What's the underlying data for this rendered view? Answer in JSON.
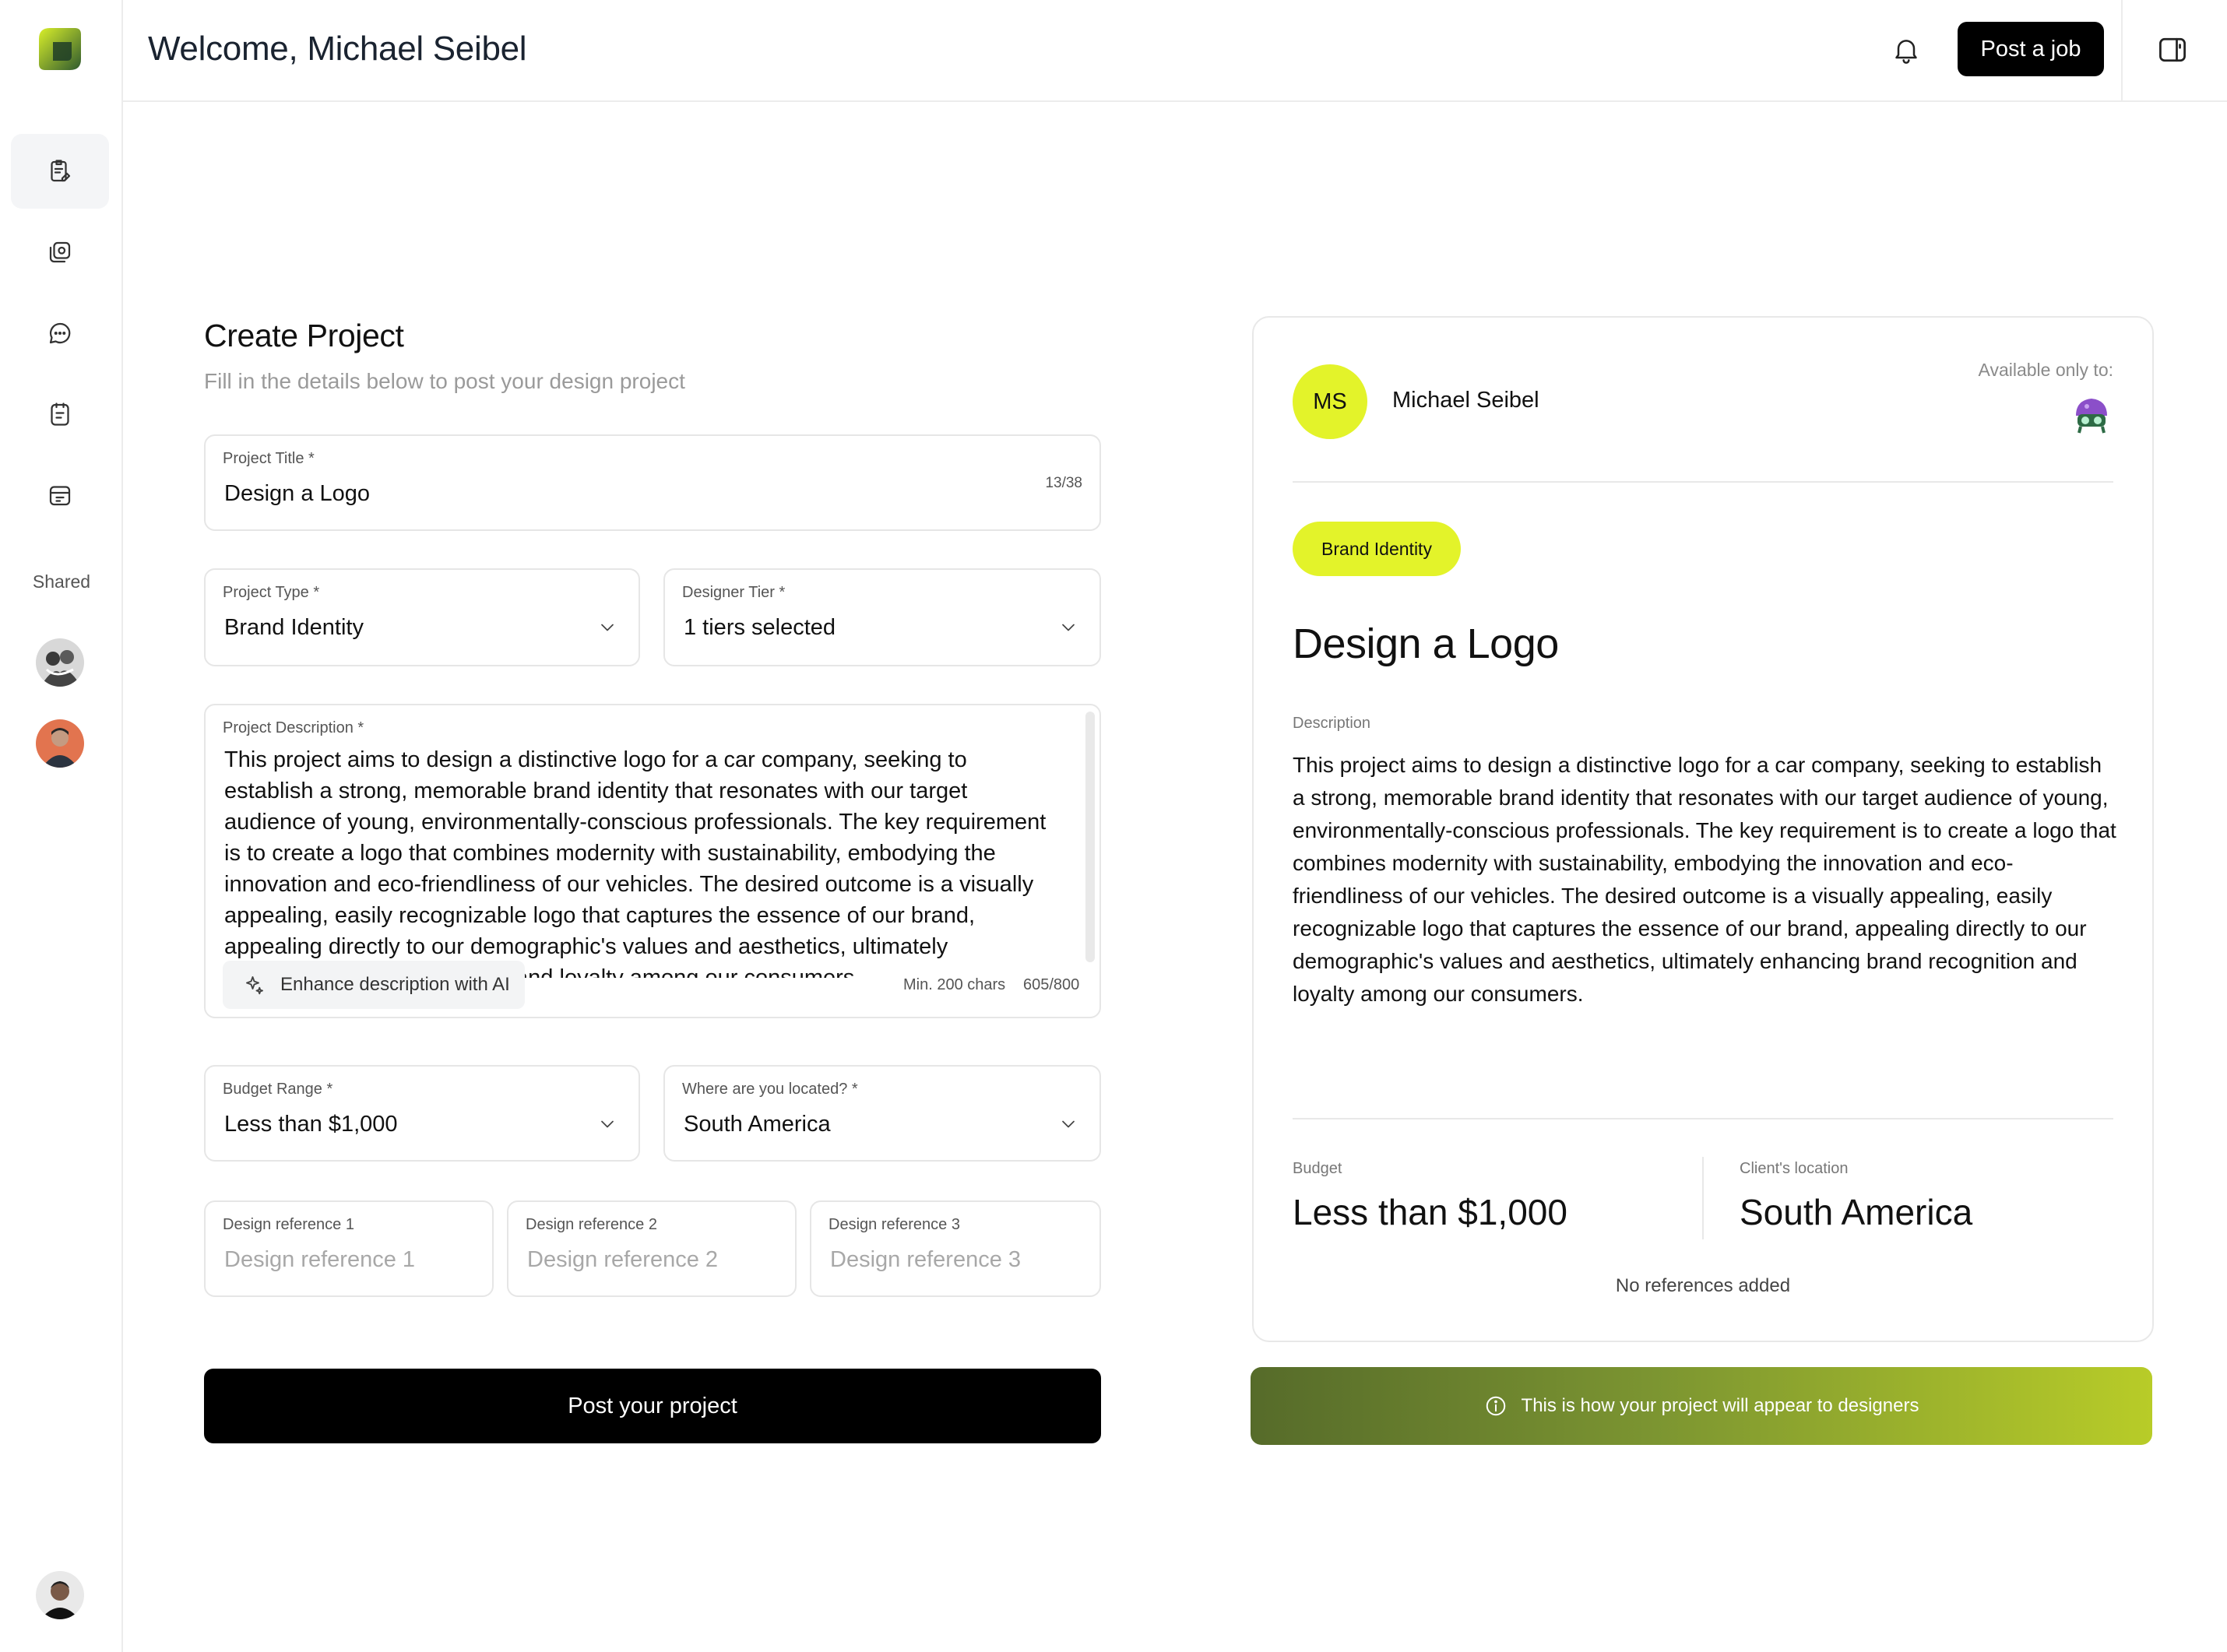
{
  "header": {
    "welcome": "Welcome, Michael Seibel",
    "post_job_label": "Post a job"
  },
  "sidebar": {
    "items": [
      {
        "icon": "clipboard-edit-icon",
        "active": true
      },
      {
        "icon": "gallery-icon",
        "active": false
      },
      {
        "icon": "chat-bubble-icon",
        "active": false
      },
      {
        "icon": "checklist-icon",
        "active": false
      },
      {
        "icon": "calendar-icon",
        "active": false
      }
    ],
    "shared_label": "Shared"
  },
  "form": {
    "title": "Create Project",
    "subtitle": "Fill in the details below to post your design project",
    "project_title": {
      "label": "Project Title *",
      "value": "Design a Logo",
      "count": "13/38"
    },
    "project_type": {
      "label": "Project Type *",
      "value": "Brand Identity"
    },
    "designer_tier": {
      "label": "Designer Tier *",
      "value": "1 tiers selected"
    },
    "description": {
      "label": "Project Description *",
      "value": "This project aims to design a distinctive logo for a car company, seeking to establish a strong, memorable brand identity that resonates with our target audience of young, environmentally-conscious professionals. The key requirement is to create a logo that combines modernity with sustainability, embodying the innovation and eco-friendliness of our vehicles. The desired outcome is a visually appealing, easily recognizable logo that captures the essence of our brand, appealing directly to our demographic's values and aesthetics, ultimately enhancing brand recognition and loyalty among our consumers.",
      "enhance_label": "Enhance description with AI",
      "min_chars": "Min. 200 chars",
      "count": "605/800"
    },
    "budget": {
      "label": "Budget Range *",
      "value": "Less than $1,000"
    },
    "location": {
      "label": "Where are you located? *",
      "value": "South America"
    },
    "references": [
      {
        "label": "Design reference 1",
        "placeholder": "Design reference 1"
      },
      {
        "label": "Design reference 2",
        "placeholder": "Design reference 2"
      },
      {
        "label": "Design reference 3",
        "placeholder": "Design reference 3"
      }
    ],
    "submit_label": "Post your project"
  },
  "preview": {
    "initials": "MS",
    "name": "Michael Seibel",
    "available_label": "Available only to:",
    "tag": "Brand Identity",
    "title": "Design a Logo",
    "description_label": "Description",
    "description": "This project aims to design a distinctive logo for a car company, seeking to establish a strong, memorable brand identity that resonates with our target audience of young, environmentally-conscious professionals. The key requirement is to create a logo that combines modernity with sustainability, embodying the innovation and eco-friendliness of our vehicles. The desired outcome is a visually appealing, easily recognizable logo that captures the essence of our brand, appealing directly to our demographic's values and aesthetics, ultimately enhancing brand recognition and loyalty among our consumers.",
    "budget_label": "Budget",
    "budget": "Less than $1,000",
    "location_label": "Client's location",
    "location": "South America",
    "no_refs": "No references added",
    "notice": "This is how your project will appear to designers"
  },
  "colors": {
    "accent": "#e3f32a",
    "button": "#000000",
    "notice_gradient_start": "#566b2a",
    "notice_gradient_end": "#b8cc28"
  }
}
